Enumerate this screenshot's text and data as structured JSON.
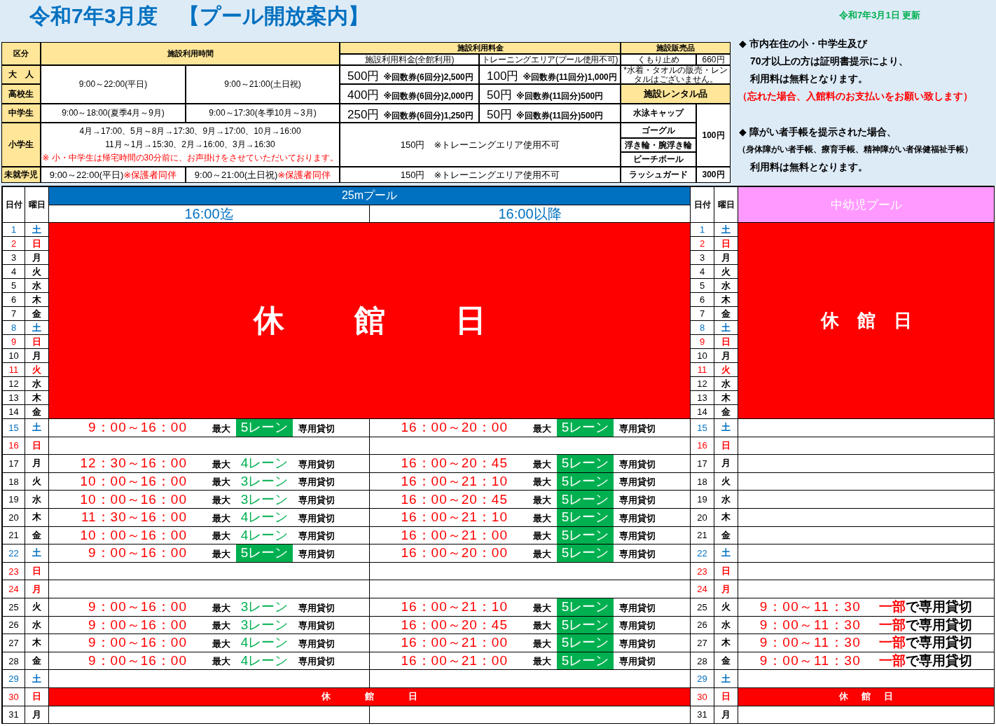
{
  "title": "令和7年3月度　【プール開放案内】",
  "updated": "令和7年3月1日 更新",
  "usage_table": {
    "header": {
      "category": "区分",
      "hours": "施設利用時間",
      "fees": "施設利用料金",
      "fee_full": "施設利用料金(全館利用)",
      "fee_training": "トレーニングエリア(プール使用不可)"
    },
    "adult_high_school": {
      "categories": [
        "大　人",
        "高校生"
      ],
      "hours": [
        "9:00～22:00(平日)",
        "9:00～21:00(土日祝)"
      ],
      "fees": [
        {
          "full_price": "500円",
          "full_tickets": "※回数券(6回分)2,500円",
          "training_price": "100円",
          "training_tickets": "※回数券(11回分)1,000円"
        },
        {
          "full_price": "400円",
          "full_tickets": "※回数券(6回分)2,000円",
          "training_price": "50円",
          "training_tickets": "※回数券(11回分)500円"
        }
      ]
    },
    "junior_high": {
      "category": "中学生",
      "hours": [
        "9:00～18:00(夏季4月～9月)",
        "9:00～17:30(冬季10月～3月)"
      ],
      "fees": {
        "full_price": "250円",
        "full_tickets": "※回数券(6回分)1,250円",
        "training_price": "50円",
        "training_tickets": "※回数券(11回分)500円"
      }
    },
    "elementary": {
      "category": "小学生",
      "hours": [
        "4月→17:00、5月～8月→17:30、9月→17:00、10月→16:00",
        "11月～1月→15:30、2月→16:00、3月→16:30"
      ],
      "notice": "※ 小・中学生は帰宅時間の30分前に、お声掛けをさせていただいております。",
      "fee": "150円　※トレーニングエリア使用不可"
    },
    "preschool": {
      "category": "未就学児",
      "hours": [
        {
          "parts": [
            {
              "text": "9:00～22:00(平日)",
              "emphasis": false
            },
            {
              "text": "※保護者同伴",
              "emphasis": true
            }
          ]
        },
        {
          "parts": [
            {
              "text": "9:00～21:00(土日祝)",
              "emphasis": false
            },
            {
              "text": "※保護者同伴",
              "emphasis": true
            }
          ]
        }
      ],
      "fee": "150円　※トレーニングエリア使用不可"
    }
  },
  "shop": {
    "sales_header": "施設販売品",
    "sales": [
      {
        "name": "くもり止め",
        "price": "660円"
      }
    ],
    "sales_note": "*水着・タオルの販売・レンタルはございません。",
    "rental_header": "施設レンタル品",
    "rentals": [
      {
        "name": "水泳キャップ"
      },
      {
        "name": "ゴーグル"
      },
      {
        "name": "浮き輪・腕浮き輪"
      },
      {
        "name": "ビーチボール"
      }
    ],
    "rental_shared_price": "100円",
    "rental_extra": {
      "name": "ラッシュガード",
      "price": "300円"
    }
  },
  "notes": [
    {
      "kind": "bullet",
      "text": "◆ 市内在住の小・中学生及び"
    },
    {
      "kind": "indent",
      "text": "70才以上の方は証明書提示により、"
    },
    {
      "kind": "indent",
      "text": "利用料は無料となります。"
    },
    {
      "kind": "warning",
      "text": "（忘れた場合、入館料のお支払いをお願い致します）"
    },
    {
      "kind": "bullet",
      "text": "◆ 障がい者手帳を提示された場合、"
    },
    {
      "kind": "small",
      "text": "（身体障がい者手帳、療育手帳、精神障がい者保健福祉手帳）"
    },
    {
      "kind": "indent",
      "text": "利用料は無料となります。"
    }
  ],
  "schedule": {
    "header": {
      "date": "日付",
      "weekday": "曜日",
      "pool": "25mプール",
      "before": "16:00迄",
      "after": "16:00以降",
      "date_2": "日付",
      "weekday_2": "曜日",
      "kids_pool": "中幼児プール"
    },
    "days": [
      {
        "date": "1",
        "weekday": "土",
        "date_2": "1",
        "weekday_2": "土",
        "color": "#0070c0",
        "main": {
          "kind": "closed",
          "label": "休　館　日"
        },
        "kids": {
          "kind": "closed",
          "label": "休　館　日"
        }
      },
      {
        "date": "2",
        "weekday": "日",
        "date_2": "2",
        "weekday_2": "日",
        "color": "#ff0000",
        "main": {
          "kind": "closed"
        },
        "kids": {
          "kind": "closed"
        }
      },
      {
        "date": "3",
        "weekday": "月",
        "date_2": "3",
        "weekday_2": "月",
        "color": "#000000",
        "main": {
          "kind": "closed"
        },
        "kids": {
          "kind": "closed"
        }
      },
      {
        "date": "4",
        "weekday": "火",
        "date_2": "4",
        "weekday_2": "火",
        "color": "#000000",
        "main": {
          "kind": "closed"
        },
        "kids": {
          "kind": "closed"
        }
      },
      {
        "date": "5",
        "weekday": "水",
        "date_2": "5",
        "weekday_2": "水",
        "color": "#000000",
        "main": {
          "kind": "closed"
        },
        "kids": {
          "kind": "closed"
        }
      },
      {
        "date": "6",
        "weekday": "木",
        "date_2": "6",
        "weekday_2": "木",
        "color": "#000000",
        "main": {
          "kind": "closed"
        },
        "kids": {
          "kind": "closed"
        }
      },
      {
        "date": "7",
        "weekday": "金",
        "date_2": "7",
        "weekday_2": "金",
        "color": "#000000",
        "main": {
          "kind": "closed"
        },
        "kids": {
          "kind": "closed"
        }
      },
      {
        "date": "8",
        "weekday": "土",
        "date_2": "8",
        "weekday_2": "土",
        "color": "#0070c0",
        "main": {
          "kind": "closed"
        },
        "kids": {
          "kind": "closed"
        }
      },
      {
        "date": "9",
        "weekday": "日",
        "date_2": "9",
        "weekday_2": "日",
        "color": "#ff0000",
        "main": {
          "kind": "closed"
        },
        "kids": {
          "kind": "closed"
        }
      },
      {
        "date": "10",
        "weekday": "月",
        "date_2": "10",
        "weekday_2": "月",
        "color": "#000000",
        "main": {
          "kind": "closed"
        },
        "kids": {
          "kind": "closed"
        }
      },
      {
        "date": "11",
        "weekday": "火",
        "date_2": "11",
        "weekday_2": "火",
        "color": "#ff0000",
        "main": {
          "kind": "closed"
        },
        "kids": {
          "kind": "closed"
        }
      },
      {
        "date": "12",
        "weekday": "水",
        "date_2": "12",
        "weekday_2": "水",
        "color": "#000000",
        "main": {
          "kind": "closed"
        },
        "kids": {
          "kind": "closed"
        }
      },
      {
        "date": "13",
        "weekday": "木",
        "date_2": "13",
        "weekday_2": "木",
        "color": "#000000",
        "main": {
          "kind": "closed"
        },
        "kids": {
          "kind": "closed"
        }
      },
      {
        "date": "14",
        "weekday": "金",
        "date_2": "14",
        "weekday_2": "金",
        "color": "#000000",
        "main": {
          "kind": "closed"
        },
        "kids": {
          "kind": "closed"
        }
      },
      {
        "date": "15",
        "weekday": "土",
        "date_2": "15",
        "weekday_2": "土",
        "color": "#0070c0",
        "main": {
          "kind": "open",
          "before": {
            "time": "9：00～16：00",
            "max": "最大",
            "lanes": "5レーン",
            "highlighted": true,
            "note": "専用貸切"
          },
          "after": {
            "time": "16：00～20：00",
            "max": "最大",
            "lanes": "5レーン",
            "highlighted": true,
            "note": "専用貸切"
          }
        }
      },
      {
        "date": "16",
        "weekday": "日",
        "date_2": "16",
        "weekday_2": "日",
        "color": "#ff0000"
      },
      {
        "date": "17",
        "weekday": "月",
        "date_2": "17",
        "weekday_2": "月",
        "color": "#000000",
        "main": {
          "kind": "open",
          "before": {
            "time": "12：30～16：00",
            "max": "最大",
            "lanes": "4レーン",
            "highlighted": false,
            "note": "専用貸切"
          },
          "after": {
            "time": "16：00～20：45",
            "max": "最大",
            "lanes": "5レーン",
            "highlighted": true,
            "note": "専用貸切"
          }
        }
      },
      {
        "date": "18",
        "weekday": "火",
        "date_2": "18",
        "weekday_2": "火",
        "color": "#000000",
        "main": {
          "kind": "open",
          "before": {
            "time": "10：00～16：00",
            "max": "最大",
            "lanes": "3レーン",
            "highlighted": false,
            "note": "専用貸切"
          },
          "after": {
            "time": "16：00～21：10",
            "max": "最大",
            "lanes": "5レーン",
            "highlighted": true,
            "note": "専用貸切"
          }
        }
      },
      {
        "date": "19",
        "weekday": "水",
        "date_2": "19",
        "weekday_2": "水",
        "color": "#000000",
        "main": {
          "kind": "open",
          "before": {
            "time": "10：00～16：00",
            "max": "最大",
            "lanes": "3レーン",
            "highlighted": false,
            "note": "専用貸切"
          },
          "after": {
            "time": "16：00～20：45",
            "max": "最大",
            "lanes": "5レーン",
            "highlighted": true,
            "note": "専用貸切"
          }
        }
      },
      {
        "date": "20",
        "weekday": "木",
        "date_2": "20",
        "weekday_2": "木",
        "color": "#000000",
        "main": {
          "kind": "open",
          "before": {
            "time": "11：30～16：00",
            "max": "最大",
            "lanes": "4レーン",
            "highlighted": false,
            "note": "専用貸切"
          },
          "after": {
            "time": "16：00～21：10",
            "max": "最大",
            "lanes": "5レーン",
            "highlighted": true,
            "note": "専用貸切"
          }
        }
      },
      {
        "date": "21",
        "weekday": "金",
        "date_2": "21",
        "weekday_2": "金",
        "color": "#000000",
        "main": {
          "kind": "open",
          "before": {
            "time": "10：00～16：00",
            "max": "最大",
            "lanes": "4レーン",
            "highlighted": false,
            "note": "専用貸切"
          },
          "after": {
            "time": "16：00～21：00",
            "max": "最大",
            "lanes": "5レーン",
            "highlighted": true,
            "note": "専用貸切"
          }
        }
      },
      {
        "date": "22",
        "weekday": "土",
        "date_2": "22",
        "weekday_2": "土",
        "color": "#0070c0",
        "main": {
          "kind": "open",
          "before": {
            "time": "9：00～16：00",
            "max": "最大",
            "lanes": "5レーン",
            "highlighted": true,
            "note": "専用貸切"
          },
          "after": {
            "time": "16：00～20：00",
            "max": "最大",
            "lanes": "5レーン",
            "highlighted": true,
            "note": "専用貸切"
          }
        }
      },
      {
        "date": "23",
        "weekday": "日",
        "date_2": "23",
        "weekday_2": "日",
        "color": "#ff0000"
      },
      {
        "date": "24",
        "weekday": "月",
        "date_2": "24",
        "weekday_2": "月",
        "color": "#ff0000"
      },
      {
        "date": "25",
        "weekday": "火",
        "date_2": "25",
        "weekday_2": "火",
        "color": "#000000",
        "main": {
          "kind": "open",
          "before": {
            "time": "9：00～16：00",
            "max": "最大",
            "lanes": "3レーン",
            "highlighted": false,
            "note": "専用貸切"
          },
          "after": {
            "time": "16：00～21：10",
            "max": "最大",
            "lanes": "5レーン",
            "highlighted": true,
            "note": "専用貸切"
          }
        },
        "kids": {
          "kind": "open",
          "time": "9：00～11：30",
          "note_parts": [
            {
              "text": "一部",
              "emphasis": true
            },
            {
              "text": "で専用貸切",
              "emphasis": false
            }
          ]
        }
      },
      {
        "date": "26",
        "weekday": "水",
        "date_2": "26",
        "weekday_2": "水",
        "color": "#000000",
        "main": {
          "kind": "open",
          "before": {
            "time": "9：00～16：00",
            "max": "最大",
            "lanes": "3レーン",
            "highlighted": false,
            "note": "専用貸切"
          },
          "after": {
            "time": "16：00～20：45",
            "max": "最大",
            "lanes": "5レーン",
            "highlighted": true,
            "note": "専用貸切"
          }
        },
        "kids": {
          "kind": "open",
          "time": "9：00～11：30",
          "note_parts": [
            {
              "text": "一部",
              "emphasis": true
            },
            {
              "text": "で専用貸切",
              "emphasis": false
            }
          ]
        }
      },
      {
        "date": "27",
        "weekday": "木",
        "date_2": "27",
        "weekday_2": "木",
        "color": "#000000",
        "main": {
          "kind": "open",
          "before": {
            "time": "9：00～16：00",
            "max": "最大",
            "lanes": "4レーン",
            "highlighted": false,
            "note": "専用貸切"
          },
          "after": {
            "time": "16：00～21：00",
            "max": "最大",
            "lanes": "5レーン",
            "highlighted": true,
            "note": "専用貸切"
          }
        },
        "kids": {
          "kind": "open",
          "time": "9：00～11：30",
          "note_parts": [
            {
              "text": "一部",
              "emphasis": true
            },
            {
              "text": "で専用貸切",
              "emphasis": false
            }
          ]
        }
      },
      {
        "date": "28",
        "weekday": "金",
        "date_2": "28",
        "weekday_2": "金",
        "color": "#000000",
        "main": {
          "kind": "open",
          "before": {
            "time": "9：00～16：00",
            "max": "最大",
            "lanes": "4レーン",
            "highlighted": false,
            "note": "専用貸切"
          },
          "after": {
            "time": "16：00～21：00",
            "max": "最大",
            "lanes": "5レーン",
            "highlighted": true,
            "note": "専用貸切"
          }
        },
        "kids": {
          "kind": "open",
          "time": "9：00～11：30",
          "note_parts": [
            {
              "text": "一部",
              "emphasis": true
            },
            {
              "text": "で専用貸切",
              "emphasis": false
            }
          ]
        }
      },
      {
        "date": "29",
        "weekday": "土",
        "date_2": "29",
        "weekday_2": "土",
        "color": "#0070c0"
      },
      {
        "date": "30",
        "weekday": "日",
        "date_2": "30",
        "weekday_2": "日",
        "color": "#ff0000",
        "main": {
          "kind": "closed",
          "label": "休　館　日"
        },
        "kids": {
          "kind": "closed",
          "label": "休　館　日"
        }
      },
      {
        "date": "31",
        "weekday": "月",
        "date_2": "31",
        "weekday_2": "月",
        "color": "#000000"
      }
    ]
  }
}
